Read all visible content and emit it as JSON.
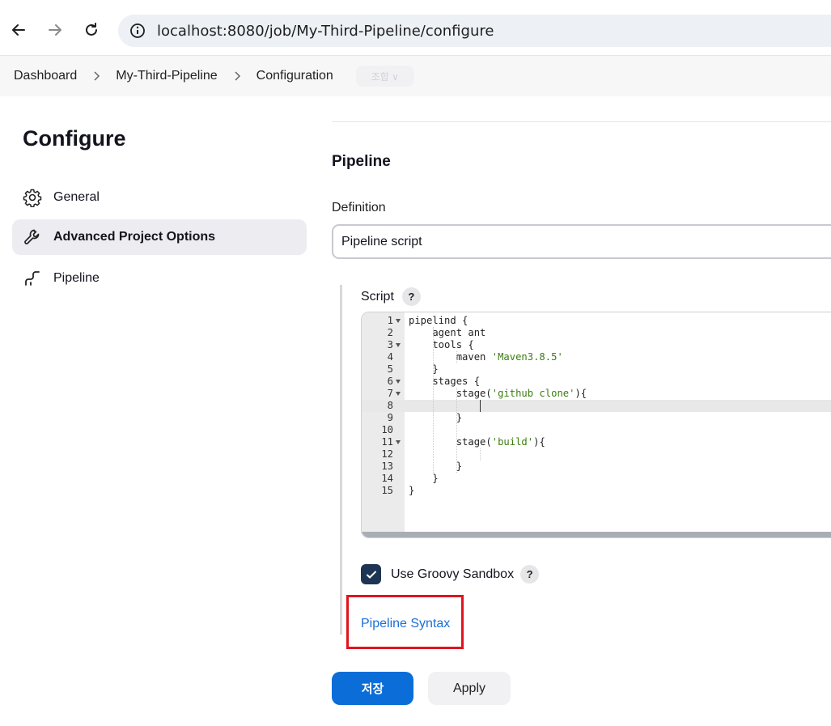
{
  "browser": {
    "url": "localhost:8080/job/My-Third-Pipeline/configure"
  },
  "breadcrumb": {
    "items": [
      "Dashboard",
      "My-Third-Pipeline",
      "Configuration"
    ],
    "ghost": "조합 ∨"
  },
  "sidebar": {
    "title": "Configure",
    "items": [
      {
        "label": "General",
        "icon": "gear-icon"
      },
      {
        "label": "Advanced Project Options",
        "icon": "wrench-icon",
        "active": true
      },
      {
        "label": "Pipeline",
        "icon": "pipeline-icon"
      }
    ]
  },
  "main": {
    "section_title": "Pipeline",
    "definition_label": "Definition",
    "definition_value": "Pipeline script",
    "script_label": "Script",
    "help_symbol": "?",
    "script_lines": [
      "pipelind {",
      "    agent ant",
      "    tools {",
      "        maven 'Maven3.8.5'",
      "    }",
      "    stages {",
      "        stage('github clone'){",
      "            ",
      "        }",
      "",
      "        stage('build'){",
      "",
      "        }",
      "    }",
      "}"
    ],
    "sandbox_label": "Use Groovy Sandbox",
    "sandbox_checked": true,
    "syntax_link": "Pipeline Syntax",
    "save_label": "저장",
    "apply_label": "Apply"
  },
  "colors": {
    "accent": "#0b6dd8",
    "highlight": "#e0141e",
    "checkbox": "#1d3553"
  }
}
